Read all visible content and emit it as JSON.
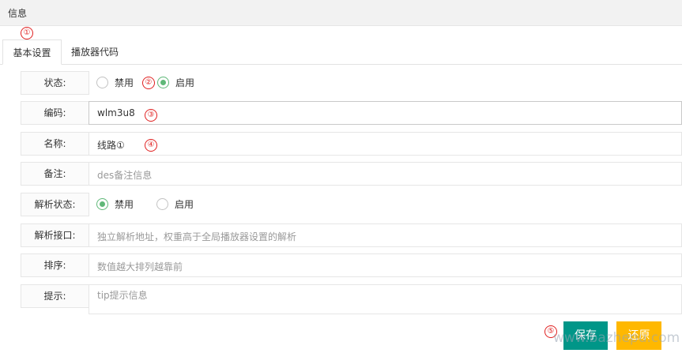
{
  "header": {
    "title": "信息"
  },
  "tabs": [
    {
      "label": "基本设置",
      "active": true
    },
    {
      "label": "播放器代码",
      "active": false
    }
  ],
  "annotations": [
    "①",
    "②",
    "③",
    "④",
    "⑤"
  ],
  "form": {
    "status": {
      "label": "状态:",
      "options": [
        {
          "label": "禁用",
          "selected": false
        },
        {
          "label": "启用",
          "selected": true
        }
      ]
    },
    "code": {
      "label": "编码:",
      "value": "wlm3u8"
    },
    "name": {
      "label": "名称:",
      "value": "线路①"
    },
    "remark": {
      "label": "备注:",
      "placeholder": "des备注信息"
    },
    "parse_status": {
      "label": "解析状态:",
      "options": [
        {
          "label": "禁用",
          "selected": true
        },
        {
          "label": "启用",
          "selected": false
        }
      ]
    },
    "parse_api": {
      "label": "解析接口:",
      "placeholder": "独立解析地址，权重高于全局播放器设置的解析"
    },
    "sort": {
      "label": "排序:",
      "placeholder": "数值越大排列越靠前"
    },
    "tip": {
      "label": "提示:",
      "placeholder": "tip提示信息"
    }
  },
  "buttons": {
    "save": "保存",
    "reset": "还原"
  },
  "watermark": "www.bazhepu.com",
  "colors": {
    "accent": "#5fb878",
    "save": "#009688",
    "reset": "#ffb800",
    "annotation": "#e02020"
  }
}
